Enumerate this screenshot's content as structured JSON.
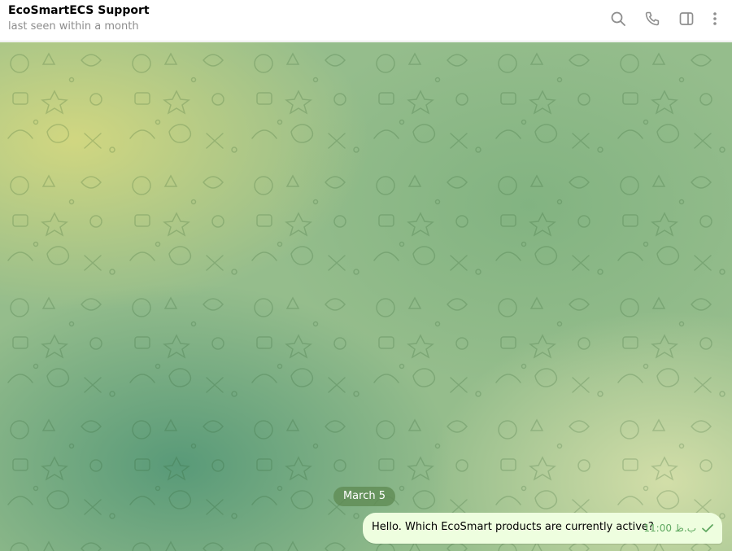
{
  "header": {
    "title": "EcoSmartECS Support",
    "status": "last seen within a month",
    "actions": [
      {
        "icon": "search-icon"
      },
      {
        "icon": "phone-icon"
      },
      {
        "icon": "sidebar-toggle-icon"
      },
      {
        "icon": "more-vertical-icon"
      }
    ]
  },
  "chat": {
    "date_separator": "March 5",
    "messages": [
      {
        "text": "Hello. Which EcoSmart products are currently active?",
        "time": "ب.ظ 11:00",
        "status_icon": "check-icon",
        "outgoing": true
      }
    ]
  },
  "colors": {
    "accent": "#5fa860",
    "outgoing_bubble": "#eefedf",
    "header_bg": "#ffffff",
    "status_text": "#8d8d8d"
  }
}
